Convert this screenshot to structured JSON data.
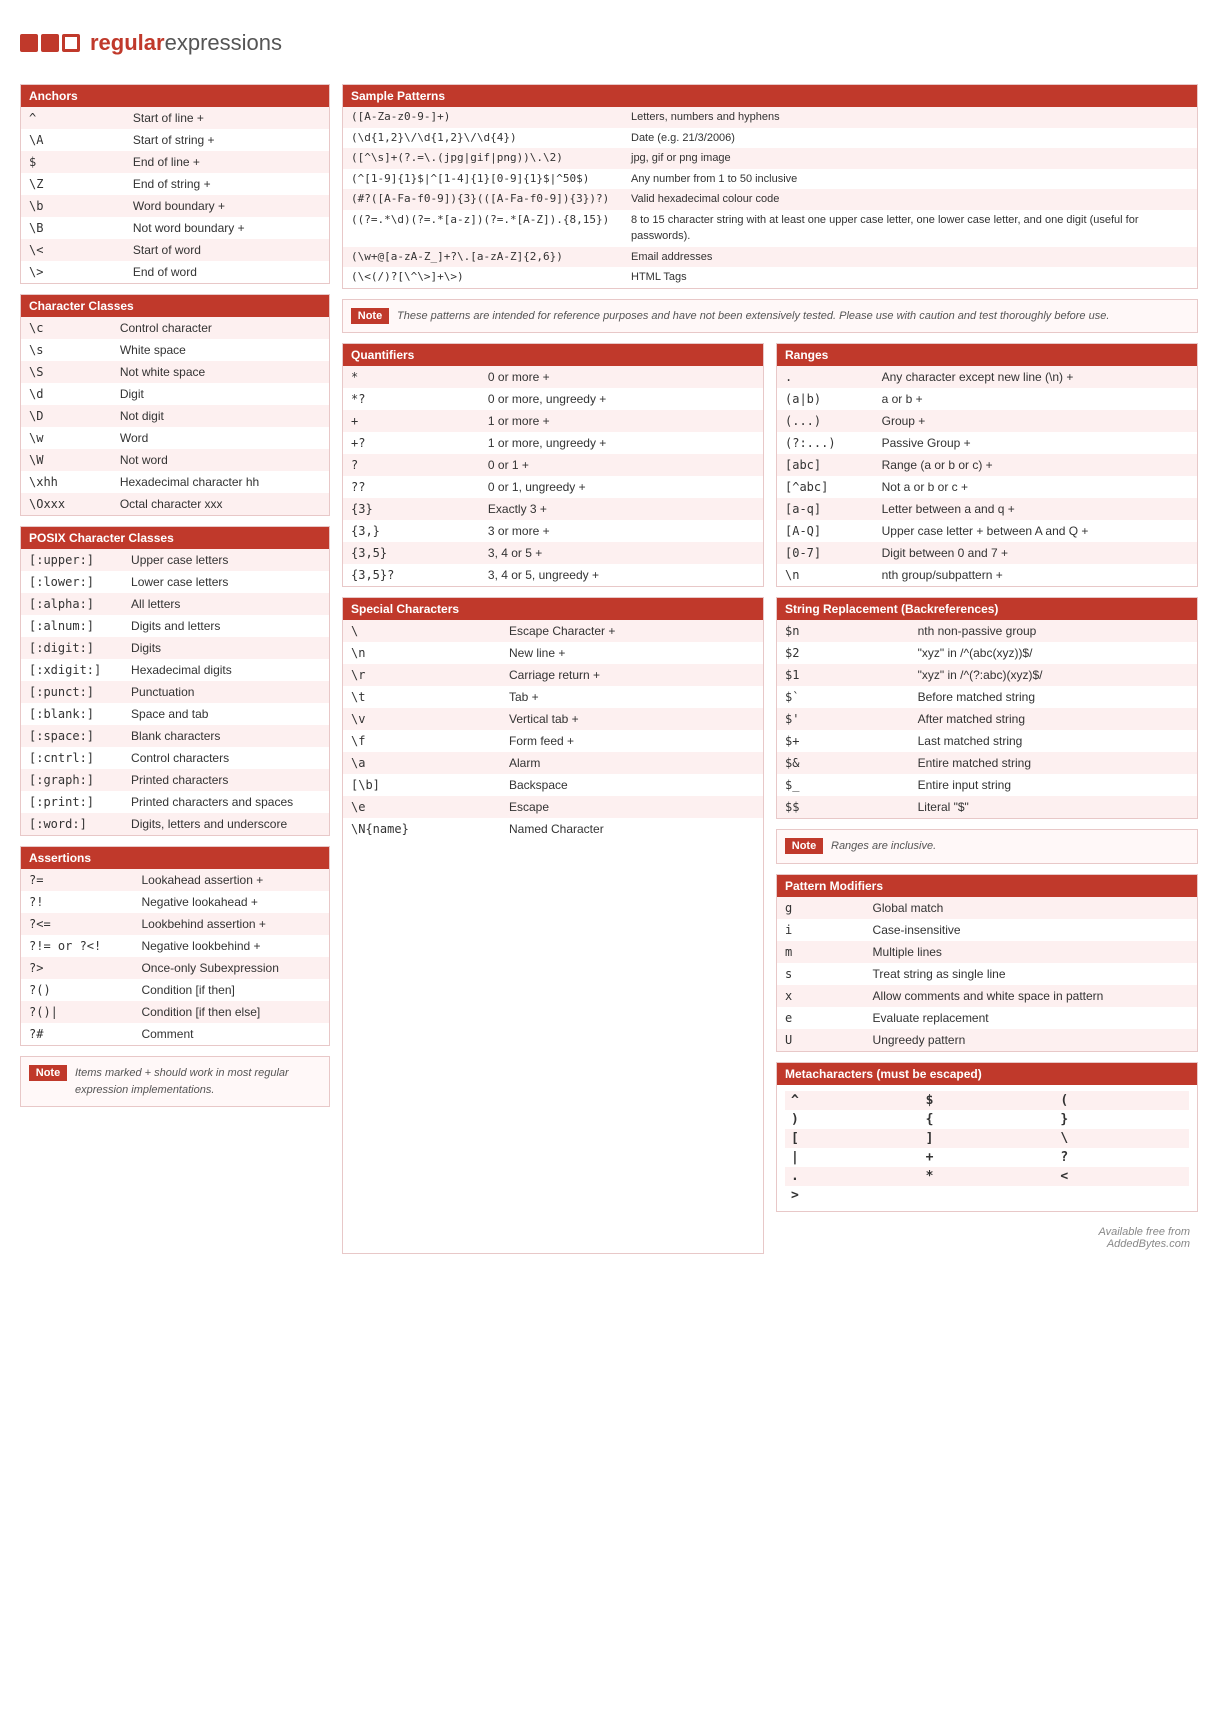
{
  "logo": {
    "text_regular": "regular",
    "text_expressions": "expressions"
  },
  "anchors": {
    "header": "Anchors",
    "rows": [
      {
        "code": "^",
        "desc": "Start of line +"
      },
      {
        "code": "\\A",
        "desc": "Start of string +"
      },
      {
        "code": "$",
        "desc": "End of line +"
      },
      {
        "code": "\\Z",
        "desc": "End of string +"
      },
      {
        "code": "\\b",
        "desc": "Word boundary +"
      },
      {
        "code": "\\B",
        "desc": "Not word boundary +"
      },
      {
        "code": "\\<",
        "desc": "Start of word"
      },
      {
        "code": "\\>",
        "desc": "End of word"
      }
    ]
  },
  "character_classes": {
    "header": "Character Classes",
    "rows": [
      {
        "code": "\\c",
        "desc": "Control character"
      },
      {
        "code": "\\s",
        "desc": "White space"
      },
      {
        "code": "\\S",
        "desc": "Not white space"
      },
      {
        "code": "\\d",
        "desc": "Digit"
      },
      {
        "code": "\\D",
        "desc": "Not digit"
      },
      {
        "code": "\\w",
        "desc": "Word"
      },
      {
        "code": "\\W",
        "desc": "Not word"
      },
      {
        "code": "\\xhh",
        "desc": "Hexadecimal character hh"
      },
      {
        "code": "\\Oxxx",
        "desc": "Octal character xxx"
      }
    ]
  },
  "posix": {
    "header": "POSIX Character Classes",
    "rows": [
      {
        "code": "[:upper:]",
        "desc": "Upper case letters"
      },
      {
        "code": "[:lower:]",
        "desc": "Lower case letters"
      },
      {
        "code": "[:alpha:]",
        "desc": "All letters"
      },
      {
        "code": "[:alnum:]",
        "desc": "Digits and letters"
      },
      {
        "code": "[:digit:]",
        "desc": "Digits"
      },
      {
        "code": "[:xdigit:]",
        "desc": "Hexadecimal digits"
      },
      {
        "code": "[:punct:]",
        "desc": "Punctuation"
      },
      {
        "code": "[:blank:]",
        "desc": "Space and tab"
      },
      {
        "code": "[:space:]",
        "desc": "Blank characters"
      },
      {
        "code": "[:cntrl:]",
        "desc": "Control characters"
      },
      {
        "code": "[:graph:]",
        "desc": "Printed characters"
      },
      {
        "code": "[:print:]",
        "desc": "Printed characters and spaces"
      },
      {
        "code": "[:word:]",
        "desc": "Digits, letters and underscore"
      }
    ]
  },
  "assertions": {
    "header": "Assertions",
    "rows": [
      {
        "code": "?=",
        "desc": "Lookahead assertion +"
      },
      {
        "code": "?!",
        "desc": "Negative lookahead +"
      },
      {
        "code": "?<=",
        "desc": "Lookbehind assertion +"
      },
      {
        "code": "?!= or ?<!",
        "desc": "Negative lookbehind +"
      },
      {
        "code": "?>",
        "desc": "Once-only Subexpression"
      },
      {
        "code": "?()",
        "desc": "Condition [if then]"
      },
      {
        "code": "?()|",
        "desc": "Condition [if then else]"
      },
      {
        "code": "?#",
        "desc": "Comment"
      }
    ]
  },
  "assertions_note": "Items marked + should work in most regular expression implementations.",
  "sample_patterns": {
    "header": "Sample Patterns",
    "rows": [
      {
        "code": "([A-Za-z0-9-]+)",
        "desc": "Letters, numbers and hyphens"
      },
      {
        "code": "(\\d{1,2}\\/\\d{1,2}\\/\\d{4})",
        "desc": "Date (e.g. 21/3/2006)"
      },
      {
        "code": "([^\\s]+(?.=\\.(jpg|gif|png))\\.\\2)",
        "desc": "jpg, gif or png image"
      },
      {
        "code": "(^[1-9]{1}$|^[1-4]{1}[0-9]{1}$|^50$)",
        "desc": "Any number from 1 to 50 inclusive"
      },
      {
        "code": "(#?([A-Fa-f0-9]){3}(([A-Fa-f0-9]){3})?)",
        "desc": "Valid hexadecimal colour code"
      },
      {
        "code": "((?=.*\\d)(?=.*[a-z])(?=.*[A-Z]).{8,15})",
        "desc": "8 to 15 character string with at least one upper case letter, one lower case letter, and one digit (useful for passwords)."
      },
      {
        "code": "(\\w+@[a-zA-Z_]+?\\.[a-zA-Z]{2,6})",
        "desc": "Email addresses"
      },
      {
        "code": "(\\<(/)?[\\^\\>]+\\>)",
        "desc": "HTML Tags"
      }
    ]
  },
  "sample_note": "These patterns are intended for reference purposes and have not been extensively tested. Please use with caution and test thoroughly before use.",
  "quantifiers": {
    "header": "Quantifiers",
    "rows": [
      {
        "code": "*",
        "desc": "0 or more +"
      },
      {
        "code": "*?",
        "desc": "0 or more, ungreedy +"
      },
      {
        "code": "+",
        "desc": "1 or more +"
      },
      {
        "code": "+?",
        "desc": "1 or more, ungreedy +"
      },
      {
        "code": "?",
        "desc": "0 or 1 +"
      },
      {
        "code": "??",
        "desc": "0 or 1, ungreedy +"
      },
      {
        "code": "{3}",
        "desc": "Exactly 3 +"
      },
      {
        "code": "{3,}",
        "desc": "3 or more +"
      },
      {
        "code": "{3,5}",
        "desc": "3, 4 or 5 +"
      },
      {
        "code": "{3,5}?",
        "desc": "3, 4 or 5, ungreedy +"
      }
    ]
  },
  "ranges": {
    "header": "Ranges",
    "rows": [
      {
        "code": ".",
        "desc": "Any character except new line (\\n) +"
      },
      {
        "code": "(a|b)",
        "desc": "a or b +"
      },
      {
        "code": "(...)",
        "desc": "Group +"
      },
      {
        "code": "(?:...)",
        "desc": "Passive Group +"
      },
      {
        "code": "[abc]",
        "desc": "Range (a or b or c) +"
      },
      {
        "code": "[^abc]",
        "desc": "Not a or b or c +"
      },
      {
        "code": "[a-q]",
        "desc": "Letter between a and q +"
      },
      {
        "code": "[A-Q]",
        "desc": "Upper case letter + between A and Q +"
      },
      {
        "code": "[0-7]",
        "desc": "Digit between 0 and 7 +"
      },
      {
        "code": "\\n",
        "desc": "nth group/subpattern +"
      }
    ]
  },
  "ranges_note": "Ranges are inclusive.",
  "special_chars": {
    "header": "Special Characters",
    "rows": [
      {
        "code": "\\",
        "desc": "Escape Character +"
      },
      {
        "code": "\\n",
        "desc": "New line +"
      },
      {
        "code": "\\r",
        "desc": "Carriage return +"
      },
      {
        "code": "\\t",
        "desc": "Tab +"
      },
      {
        "code": "\\v",
        "desc": "Vertical tab +"
      },
      {
        "code": "\\f",
        "desc": "Form feed +"
      },
      {
        "code": "\\a",
        "desc": "Alarm"
      },
      {
        "code": "[\\b]",
        "desc": "Backspace"
      },
      {
        "code": "\\e",
        "desc": "Escape"
      },
      {
        "code": "\\N{name}",
        "desc": "Named Character"
      }
    ]
  },
  "string_replacement": {
    "header": "String Replacement (Backreferences)",
    "rows": [
      {
        "code": "$n",
        "desc": "nth non-passive group"
      },
      {
        "code": "$2",
        "desc": "\"xyz\" in /^(abc(xyz))$/"
      },
      {
        "code": "$1",
        "desc": "\"xyz\" in /^(?:abc)(xyz)$/"
      },
      {
        "code": "$`",
        "desc": "Before matched string"
      },
      {
        "code": "$'",
        "desc": "After matched string"
      },
      {
        "code": "$+",
        "desc": "Last matched string"
      },
      {
        "code": "$&",
        "desc": "Entire matched string"
      },
      {
        "code": "$_",
        "desc": "Entire input string"
      },
      {
        "code": "$$",
        "desc": "Literal \"$\""
      }
    ]
  },
  "pattern_modifiers": {
    "header": "Pattern Modifiers",
    "rows": [
      {
        "code": "g",
        "desc": "Global match"
      },
      {
        "code": "i",
        "desc": "Case-insensitive"
      },
      {
        "code": "m",
        "desc": "Multiple lines"
      },
      {
        "code": "s",
        "desc": "Treat string as single line"
      },
      {
        "code": "x",
        "desc": "Allow comments and white space in pattern"
      },
      {
        "code": "e",
        "desc": "Evaluate replacement"
      },
      {
        "code": "U",
        "desc": "Ungreedy pattern"
      }
    ]
  },
  "metacharacters": {
    "header": "Metacharacters (must be escaped)",
    "chars": [
      "^",
      "$",
      "(",
      ")",
      "{",
      "}",
      "[",
      "]",
      "\\",
      "|",
      "+",
      "?",
      ".",
      "*",
      "<",
      ">"
    ]
  },
  "footer": {
    "available": "Available free from",
    "site": "AddedBytes.com"
  }
}
